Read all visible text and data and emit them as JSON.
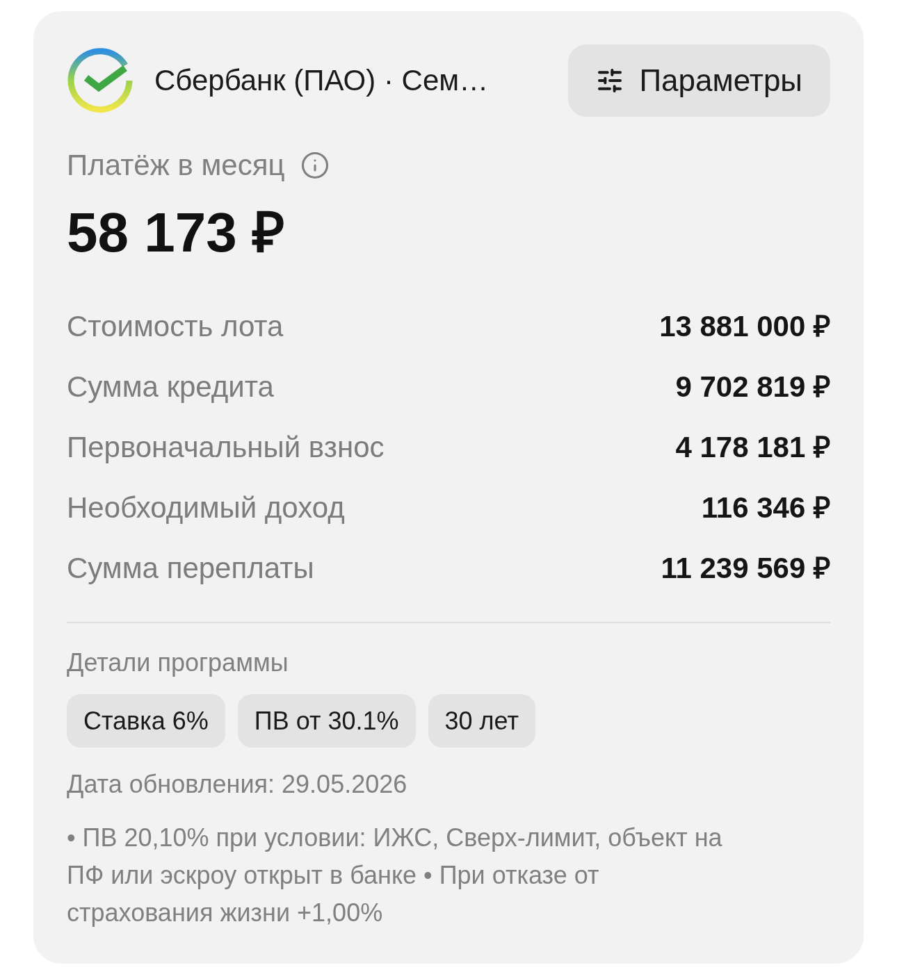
{
  "header": {
    "title": "Сбербанк (ПАО) · Сем…",
    "params_button": "Параметры"
  },
  "payment": {
    "label": "Платёж в месяц",
    "amount": "58 173 ₽"
  },
  "details": [
    {
      "label": "Стоимость лота",
      "value": "13 881 000 ₽"
    },
    {
      "label": "Сумма кредита",
      "value": "9 702 819 ₽"
    },
    {
      "label": "Первоначальный взнос",
      "value": "4 178 181 ₽"
    },
    {
      "label": "Необходимый доход",
      "value": "116 346 ₽"
    },
    {
      "label": "Сумма переплаты",
      "value": "11 239 569 ₽"
    }
  ],
  "program": {
    "title": "Детали программы",
    "tags": [
      "Ставка 6%",
      "ПВ от 30.1%",
      "30 лет"
    ]
  },
  "updated": "Дата обновления: 29.05.2026",
  "note": "• ПВ 20,10% при условии: ИЖС, Сверх-лимит, объект на ПФ или эскроу открыт в банке • При отказе от страхования жизни +1,00%"
}
